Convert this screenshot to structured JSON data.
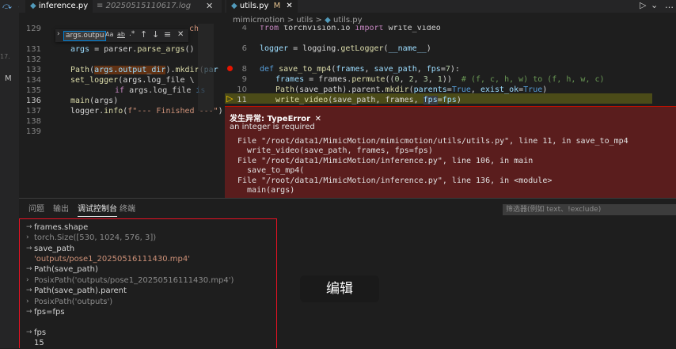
{
  "toolbar": {
    "icons": [
      "step-over-icon",
      "step-into-icon",
      "step-out-icon",
      "restart-icon",
      "stop-icon"
    ]
  },
  "left_strip": {
    "text1": "17.",
    "badge": "M"
  },
  "left_editor": {
    "tabs": [
      {
        "label": "inference.py",
        "active": true
      },
      {
        "label": "20250515110617.log",
        "active": false
      }
    ],
    "find": {
      "value": "args.outpu",
      "aa": "Aa",
      "ab": "ab"
    }
  },
  "right_editor": {
    "tab": {
      "label": "utils.py",
      "badge": "M"
    },
    "breadcrumb": {
      "part1": "mimicmotion",
      "sep": ">",
      "part2": "utils",
      "part3": "utils.py"
    }
  },
  "exception": {
    "title": "发生异常: TypeError",
    "message": "an integer is required",
    "trace": [
      "File \"/root/data1/MimicMotion/mimicmotion/utils/utils.py\", line 11, in save_to_mp4",
      "  write_video(save_path, frames, fps=fps)",
      "File \"/root/data1/MimicMotion/inference.py\", line 106, in main",
      "  save_to_mp4(",
      "File \"/root/data1/MimicMotion/inference.py\", line 136, in <module>",
      "  main(args)"
    ]
  },
  "panel": {
    "tabs": [
      "问题",
      "输出",
      "调试控制台",
      "终端"
    ],
    "filter_placeholder": "筛选器(例如 text、!exclude)",
    "console": [
      {
        "kind": "input",
        "text": "frames.shape"
      },
      {
        "kind": "output",
        "text": "torch.Size([530, 1024, 576, 3])"
      },
      {
        "kind": "input",
        "text": "save_path"
      },
      {
        "kind": "string",
        "text": "'outputs/pose1_20250516111430.mp4'"
      },
      {
        "kind": "input",
        "text": "Path(save_path)"
      },
      {
        "kind": "output",
        "text": "PosixPath('outputs/pose1_20250516111430.mp4')"
      },
      {
        "kind": "input",
        "text": "Path(save_path).parent"
      },
      {
        "kind": "output",
        "text": "PosixPath('outputs')"
      },
      {
        "kind": "input",
        "text": "fps=fps"
      },
      {
        "kind": "blank",
        "text": ""
      },
      {
        "kind": "input",
        "text": "fps"
      },
      {
        "kind": "output",
        "text": "15"
      }
    ]
  },
  "tooltip": {
    "label": "编辑"
  },
  "colors": {
    "exception_bg": "#5a1d1d",
    "highlight_line": "#4b4b18",
    "breakpoint": "#e51400"
  }
}
